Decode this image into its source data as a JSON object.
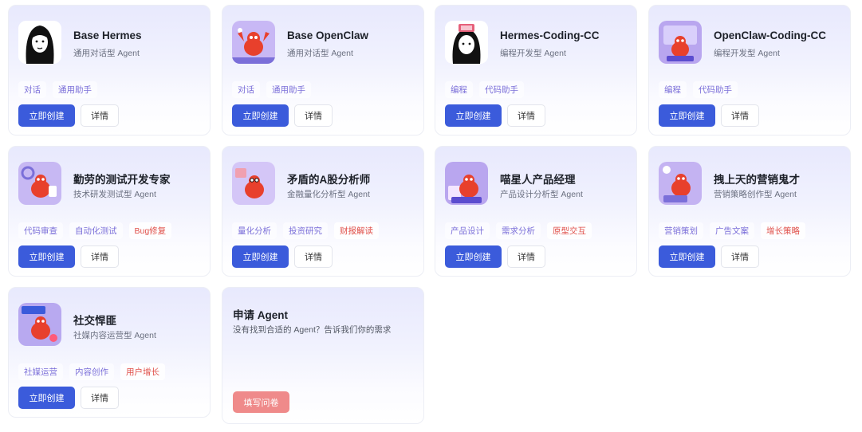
{
  "agents": [
    {
      "title": "Base Hermes",
      "subtitle": "通用对话型 Agent",
      "tags": [
        "对话",
        "通用助手"
      ],
      "create": "立即创建",
      "detail": "详情",
      "icon": "hermes-portrait-icon"
    },
    {
      "title": "Base OpenClaw",
      "subtitle": "通用对话型 Agent",
      "tags": [
        "对话",
        "通用助手"
      ],
      "create": "立即创建",
      "detail": "详情",
      "icon": "lobster-icon"
    },
    {
      "title": "Hermes-Coding-CC",
      "subtitle": "编程开发型 Agent",
      "tags": [
        "编程",
        "代码助手"
      ],
      "create": "立即创建",
      "detail": "详情",
      "icon": "hermes-coder-icon"
    },
    {
      "title": "OpenClaw-Coding-CC",
      "subtitle": "编程开发型 Agent",
      "tags": [
        "编程",
        "代码助手"
      ],
      "create": "立即创建",
      "detail": "详情",
      "icon": "lobster-coder-icon"
    },
    {
      "title": "勤劳的测试开发专家",
      "subtitle": "技术研发测试型 Agent",
      "tags": [
        "代码审查",
        "自动化测试",
        "Bug修复"
      ],
      "create": "立即创建",
      "detail": "详情",
      "icon": "lobster-tester-icon"
    },
    {
      "title": "矛盾的A股分析师",
      "subtitle": "金融量化分析型 Agent",
      "tags": [
        "量化分析",
        "投资研究",
        "财报解读"
      ],
      "create": "立即创建",
      "detail": "详情",
      "icon": "lobster-analyst-icon"
    },
    {
      "title": "喵星人产品经理",
      "subtitle": "产品设计分析型 Agent",
      "tags": [
        "产品设计",
        "需求分析",
        "原型交互"
      ],
      "create": "立即创建",
      "detail": "详情",
      "icon": "lobster-pm-icon"
    },
    {
      "title": "拽上天的营销鬼才",
      "subtitle": "营销策略创作型 Agent",
      "tags": [
        "营销策划",
        "广告文案",
        "增长策略"
      ],
      "create": "立即创建",
      "detail": "详情",
      "icon": "lobster-marketer-icon"
    },
    {
      "title": "社交悍匪",
      "subtitle": "社媒内容运营型 Agent",
      "tags": [
        "社媒运营",
        "内容创作",
        "用户增长"
      ],
      "create": "立即创建",
      "detail": "详情",
      "icon": "lobster-social-icon"
    }
  ],
  "apply": {
    "title": "申请 Agent",
    "desc": "没有找到合适的 Agent？告诉我们你的需求",
    "button": "填写问卷"
  },
  "colors": {
    "primary": "#3b5bdb",
    "tag": "#7b6fd9",
    "tag_highlight": "#e0504a",
    "apply_button": "#ef8a8a"
  }
}
